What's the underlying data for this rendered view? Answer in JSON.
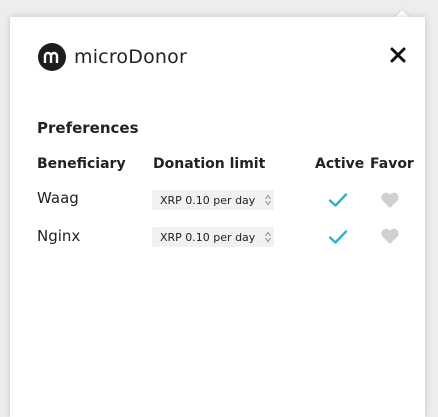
{
  "app": {
    "name": "microDonor",
    "logo_letter": "m"
  },
  "close_icon": "close-icon",
  "preferences": {
    "title": "Preferences",
    "columns": {
      "beneficiary": "Beneficiary",
      "donation_limit": "Donation limit",
      "active": "Active",
      "favor": "Favor"
    },
    "rows": [
      {
        "beneficiary": "Waag",
        "donation_limit": "XRP 0.10 per day",
        "active": true,
        "favor": false
      },
      {
        "beneficiary": "Nginx",
        "donation_limit": "XRP 0.10 per day",
        "active": true,
        "favor": false
      }
    ]
  },
  "colors": {
    "accent_check": "#2fb3c0",
    "heart_inactive": "#d0d0d0",
    "logo_bg": "#1d1d1d",
    "input_bg": "#f1f1f1"
  }
}
